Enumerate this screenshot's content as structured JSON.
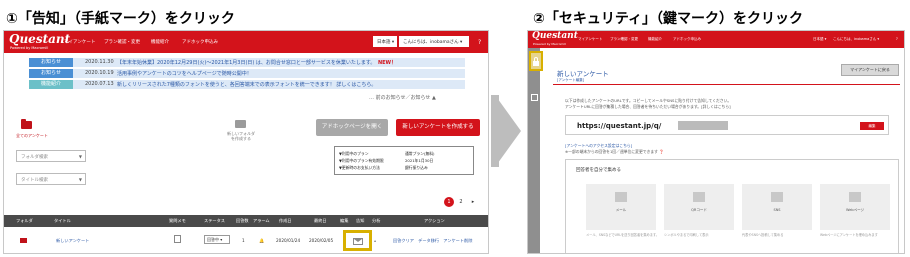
{
  "steps": {
    "step1": "①「告知」（手紙マーク）をクリック",
    "step2": "②「セキュリティ」（鍵マーク）をクリック"
  },
  "screen1": {
    "logo": "Questant",
    "logo_sub": "Powered by Macromill",
    "nav": [
      "マイアンケート",
      "プラン確認・変更",
      "機能紹介",
      "アドホック申込み"
    ],
    "language": "日本語 ▾",
    "user": "こんにちは、inobamaさん ▾",
    "help": "?",
    "news": [
      {
        "badge": "お知らせ",
        "badge_color": "#4a8fd4",
        "date": "2020.11.30",
        "text": "【年末年始休業】2020年12月29日(火)～2021年1月3日(日) は、お問合せ窓口と一部サービスを休業いたします。",
        "new": "NEW！"
      },
      {
        "badge": "お知らせ",
        "badge_color": "#4a8fd4",
        "date": "2020.10.19",
        "text": "活用事例やアンケートのコツをヘルプページで随時公開中！",
        "new": ""
      },
      {
        "badge": "機能紹介",
        "badge_color": "#6cc0c8",
        "date": "2020.07.13",
        "text": "新しくリリースされた7種類のフォントを使うと、各回答端末での表示フォントを統一できます！ 詳しくはこちら。",
        "new": ""
      }
    ],
    "news_link": "… 前のお知らせ／お知らせ ▲",
    "all_surveys": "全てのアンケート",
    "new_folder": "新しいフォルダを作成する",
    "btn_adhoc": "アドホックページを開く",
    "btn_create": "新しいアンケートを作成する",
    "folder_search": "フォルダ検索",
    "title_search": "タイトル検索",
    "legend": [
      [
        "▼利用中のプラン",
        "通常プラン(無料)"
      ],
      [
        "▼利用中のプラン有効期限",
        "2021年1月30日"
      ],
      [
        "▼更新時のお支払い方法",
        "銀行振り込み"
      ]
    ],
    "pager": [
      "1",
      "2",
      "▸"
    ],
    "table_headers": [
      "フォルダ",
      "タイトル",
      "質問メモ",
      "ステータス",
      "回答数",
      "アラーム",
      "作成日",
      "最終日",
      "編集",
      "告知",
      "分析",
      "アクション"
    ],
    "row": {
      "title": "新しいアンケート",
      "status": "回答中 ▾",
      "count": "1",
      "created": "2020/01/24",
      "final": "2020/02/05",
      "actions": "回答クリア　データ移行　アンケート削除"
    }
  },
  "screen2": {
    "logo": "Questant",
    "logo_sub": "Powered by Macromill",
    "nav": [
      "マイアンケート",
      "プラン確認・変更",
      "機能紹介",
      "アドホック申込み"
    ],
    "language": "日本語 ▾",
    "user": "こんにちは、inobamaさん ▾",
    "help": "?",
    "page_title": "新しいアンケート",
    "breadcrumb": "[アンケート編集]",
    "btn_my": "マイアンケートに戻る",
    "desc1": "以下は作成したアンケートのURLです。コピーしてメールやSNSに貼り付けて告知してください。",
    "desc2": "アンケートURLに回答が集積した場合、回答者を待ちいただい場合があります。[詳しくはこちら]",
    "url": "https://questant.jp/q/",
    "url_btn": "編集",
    "link_setting": "[アンケートへのアクセス設定はこちら]",
    "link_desc": "※一部の端末からの回答を1回／週単位に変更できます ❓",
    "cards_title": "回答者を自分で集める",
    "cards": [
      {
        "label": "メール",
        "desc": "メール、SNSなどでURLを送り回答者を集めます。"
      },
      {
        "label": "QRコード",
        "desc": "シンボルやまるで印刷して表示"
      },
      {
        "label": "SNS",
        "desc": "代表やSNSへ投稿して集める"
      },
      {
        "label": "Webページ",
        "desc": "Webページにアンケートを埋め込みます"
      }
    ]
  }
}
